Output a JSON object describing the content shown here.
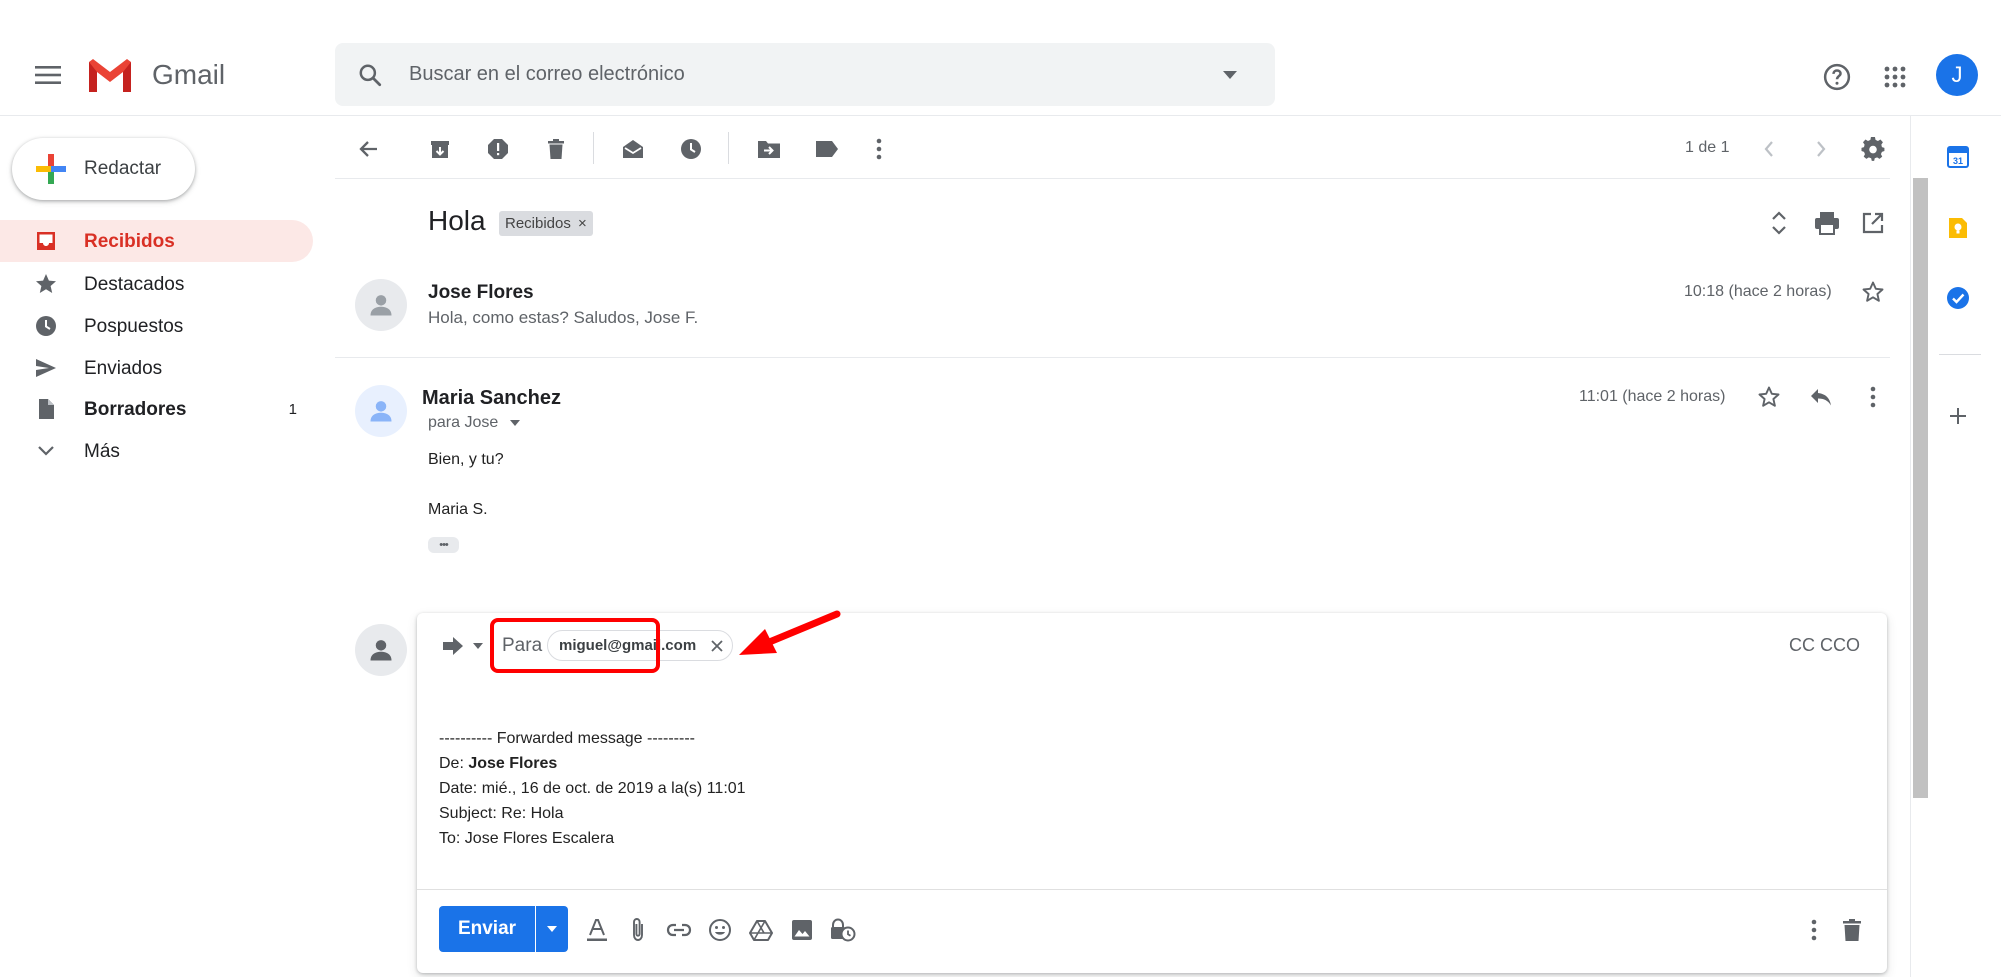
{
  "header": {
    "app_name": "Gmail",
    "search_placeholder": "Buscar en el correo electrónico",
    "avatar_letter": "J"
  },
  "sidebar": {
    "compose_label": "Redactar",
    "items": [
      {
        "label": "Recibidos",
        "icon": "inbox-icon",
        "active": true
      },
      {
        "label": "Destacados",
        "icon": "star-icon"
      },
      {
        "label": "Pospuestos",
        "icon": "clock-icon"
      },
      {
        "label": "Enviados",
        "icon": "send-icon"
      },
      {
        "label": "Borradores",
        "icon": "draft-icon",
        "count": "1"
      },
      {
        "label": "Más",
        "icon": "chevron-down-icon"
      }
    ]
  },
  "toolbar": {
    "pagination": "1 de 1"
  },
  "conversation": {
    "subject": "Hola",
    "label_chip": "Recibidos",
    "label_chip_close": "×",
    "messages": [
      {
        "sender": "Jose Flores",
        "snippet": "Hola, como estas? Saludos, Jose F.",
        "time": "10:18 (hace 2 horas)"
      },
      {
        "sender": "Maria Sanchez",
        "to": "para Jose",
        "time": "11:01 (hace 2 horas)",
        "body_line1": "Bien, y tu?",
        "body_line2": "Maria S.",
        "ellipsis": "•••"
      }
    ]
  },
  "reply": {
    "to_label": "Para",
    "recipient": "miguel@gmail.com",
    "cc_label": "CC CCO",
    "forwarded_header": "---------- Forwarded message ---------",
    "from_label": "De: ",
    "from_name": "Jose Flores",
    "date_line": "Date: mié., 16 de oct. de 2019 a la(s) 11:01",
    "subject_line": "Subject: Re: Hola",
    "to_line": "To: Jose Flores Escalera",
    "send_label": "Enviar"
  },
  "colors": {
    "accent_blue": "#1a73e8",
    "active_red": "#d93025",
    "highlight_red": "#ff0000"
  }
}
